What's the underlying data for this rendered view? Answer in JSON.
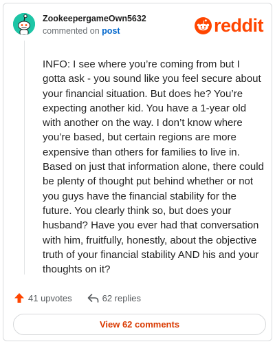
{
  "brand": {
    "name": "reddit",
    "color": "#ff4500"
  },
  "comment": {
    "username": "ZookeepergameOwn5632",
    "meta_prefix": "commented on",
    "meta_link": "post",
    "body": "INFO: I see where you’re coming from but I gotta ask - you sound like you feel secure about your financial situation. But does he? You’re expecting another kid. You have a 1-year old with another on the way. I don’t know where you’re based, but certain regions are more expensive than others for families to live in. Based on just that information alone, there could be plenty of thought put behind whether or not you guys have the financial stability for the future. You clearly think so, but does your husband? Have you ever had that conversation with him, fruitfully, honestly, about the objective truth of your financial stability AND his and your thoughts on it?",
    "avatar_color": "#1ec5a6"
  },
  "actions": {
    "upvotes": "41 upvotes",
    "replies": "62 replies",
    "upvote_icon": "upvote-arrow-icon",
    "reply_icon": "reply-arrow-icon"
  },
  "view_button": {
    "label": "View 62 comments",
    "color": "#d93900"
  }
}
